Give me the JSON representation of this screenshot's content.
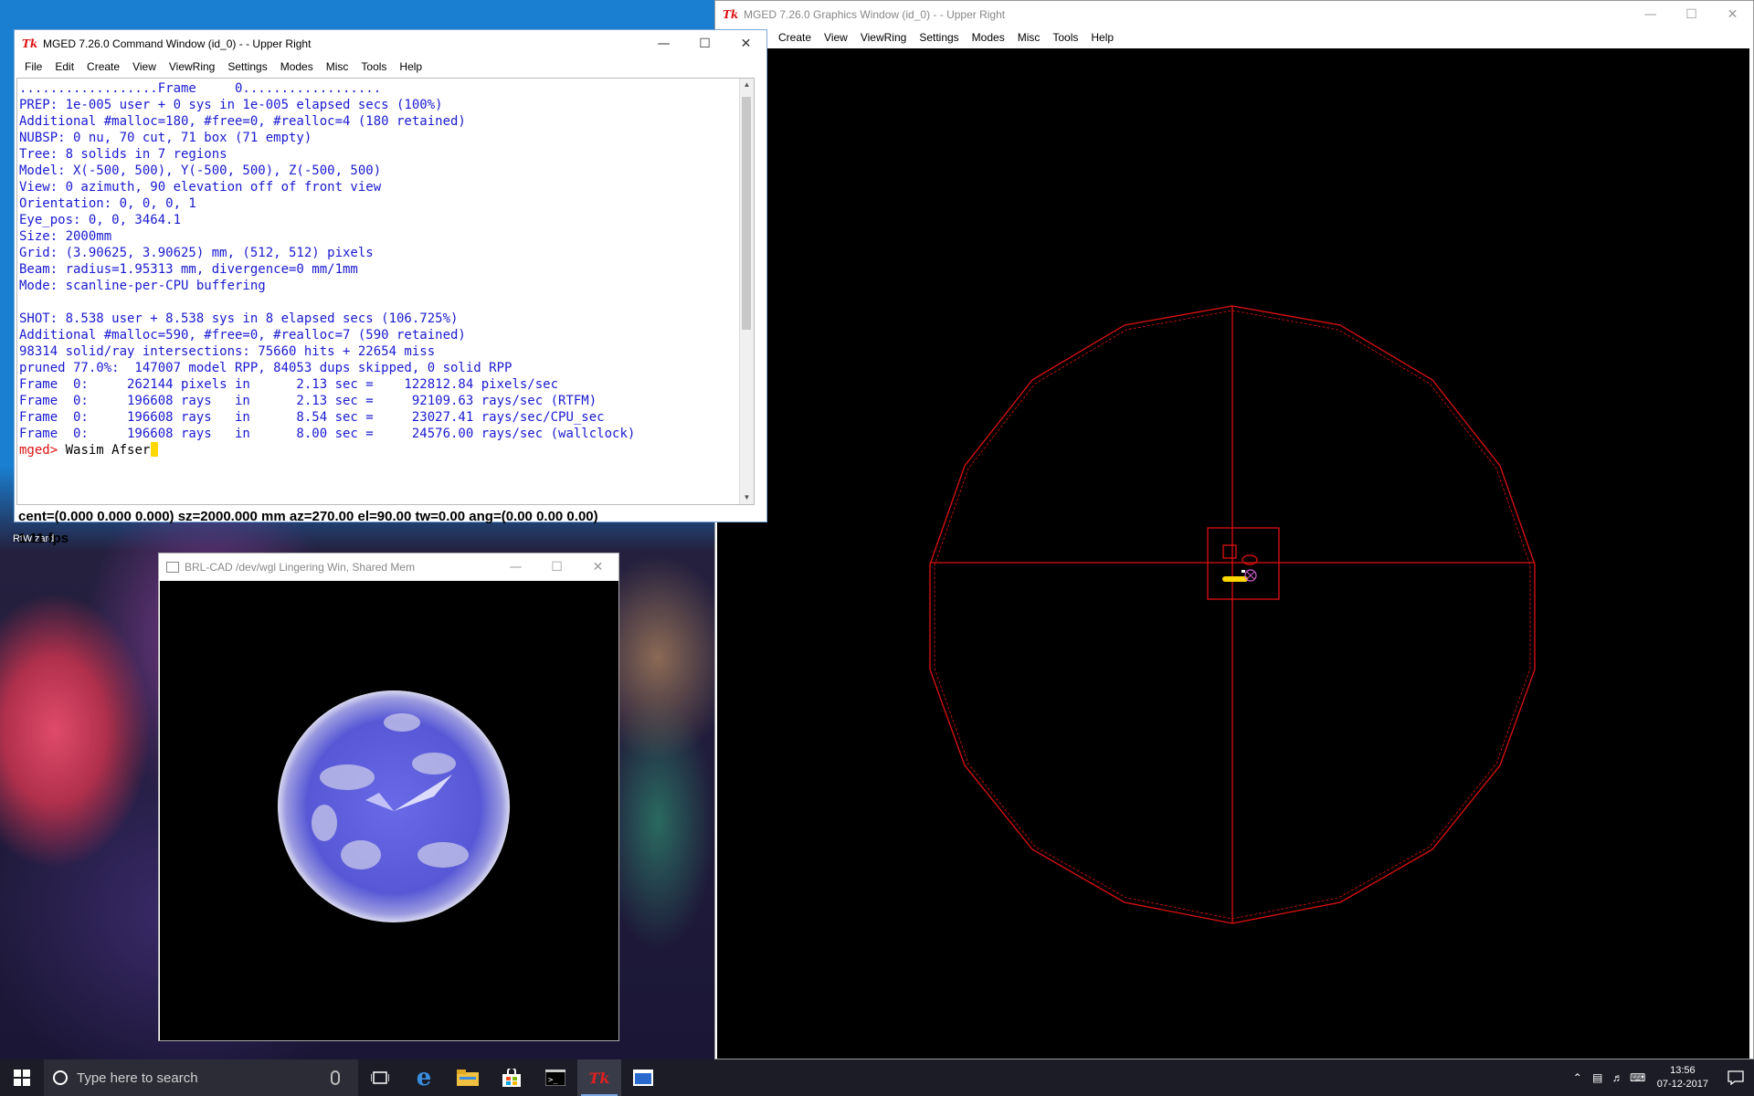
{
  "desktop": {
    "icon_labels": [
      "RtWizard"
    ]
  },
  "command_window": {
    "title": "MGED 7.26.0 Command Window (id_0) -  - Upper Right",
    "menu": [
      "File",
      "Edit",
      "Create",
      "View",
      "ViewRing",
      "Settings",
      "Modes",
      "Misc",
      "Tools",
      "Help"
    ],
    "console_lines": [
      "..................Frame     0..................",
      "PREP: 1e-005 user + 0 sys in 1e-005 elapsed secs (100%)",
      "Additional #malloc=180, #free=0, #realloc=4 (180 retained)",
      "NUBSP: 0 nu, 70 cut, 71 box (71 empty)",
      "Tree: 8 solids in 7 regions",
      "Model: X(-500, 500), Y(-500, 500), Z(-500, 500)",
      "View: 0 azimuth, 90 elevation off of front view",
      "Orientation: 0, 0, 0, 1",
      "Eye_pos: 0, 0, 3464.1",
      "Size: 2000mm",
      "Grid: (3.90625, 3.90625) mm, (512, 512) pixels",
      "Beam: radius=1.95313 mm, divergence=0 mm/1mm",
      "Mode: scanline-per-CPU buffering",
      "",
      "SHOT: 8.538 user + 8.538 sys in 8 elapsed secs (106.725%)",
      "Additional #malloc=590, #free=0, #realloc=7 (590 retained)",
      "98314 solid/ray intersections: 75660 hits + 22654 miss",
      "pruned 77.0%:  147007 model RPP, 84053 dups skipped, 0 solid RPP",
      "Frame  0:     262144 pixels in      2.13 sec =    122812.84 pixels/sec",
      "Frame  0:     196608 rays   in      2.13 sec =     92109.63 rays/sec (RTFM)",
      "Frame  0:     196608 rays   in      8.54 sec =     23027.41 rays/sec/CPU_sec",
      "Frame  0:     196608 rays   in      8.00 sec =     24576.00 rays/sec (wallclock)",
      ""
    ],
    "prompt": "mged>",
    "input_value": " Wasim Afser",
    "status_line": "cent=(0.000 0.000 0.000) sz=2000.000  mm  az=270.00  el=90.00  tw=0.00  ang=(0.00 0.00 0.00)",
    "fps": "1.11 fps"
  },
  "graphics_window": {
    "title": "MGED 7.26.0 Graphics Window (id_0) -  - Upper Right",
    "menu": [
      "Create",
      "View",
      "ViewRing",
      "Settings",
      "Modes",
      "Misc",
      "Tools",
      "Help"
    ],
    "wire_color": "#e01010"
  },
  "framebuffer_window": {
    "title": "BRL-CAD /dev/wgl Lingering Win, Shared Mem",
    "sphere_color": "#5a5ad8"
  },
  "taskbar": {
    "search_placeholder": "Type here to search",
    "time": "13:56",
    "date": "07-12-2017"
  }
}
